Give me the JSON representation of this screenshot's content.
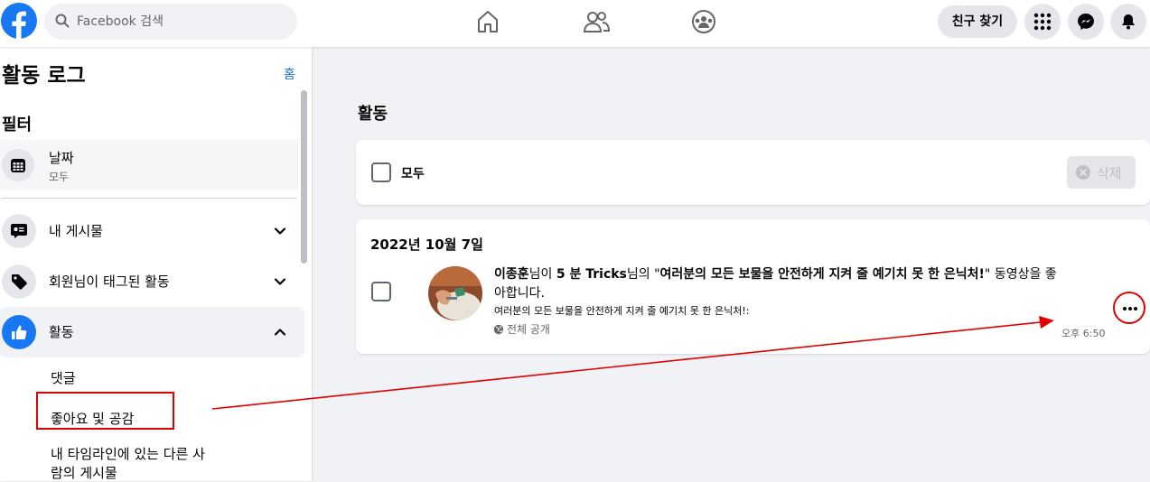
{
  "header": {
    "search_placeholder": "Facebook 검색",
    "find_friends_label": "친구 찾기",
    "accent_color": "#1877f2"
  },
  "sidebar": {
    "title": "활동 로그",
    "home_link": "홈",
    "filter_heading": "필터",
    "date_filter": {
      "label": "날짜",
      "value": "모두"
    },
    "items": [
      {
        "label": "내 게시물"
      },
      {
        "label": "회원님이 태그된 활동"
      },
      {
        "label": "활동"
      }
    ],
    "subitems": [
      "댓글",
      "좋아요 및 공감",
      "내 타임라인에 있는 다른 사",
      "람의 게시물"
    ]
  },
  "main": {
    "title": "활동",
    "select_all_label": "모두",
    "delete_label": "삭제",
    "date_heading": "2022년 10월 7일",
    "activity": {
      "actor": "이종훈",
      "t1": "님이 ",
      "page": "5 분 Tricks",
      "t2": "님의 \"",
      "post_title": "여러분의 모든 보물을 안전하게 지켜 줄 예기치 못 한 은닉처!",
      "t3": "\" 동영상을 좋",
      "t4": "아합니다.",
      "subtitle": "여러분의 모든 보물을 안전하게 지켜 줄 예기치 못 한 은닉처!:",
      "privacy": "전체 공개",
      "time": "오후 6:50"
    }
  },
  "annotation_color": "#e00000"
}
